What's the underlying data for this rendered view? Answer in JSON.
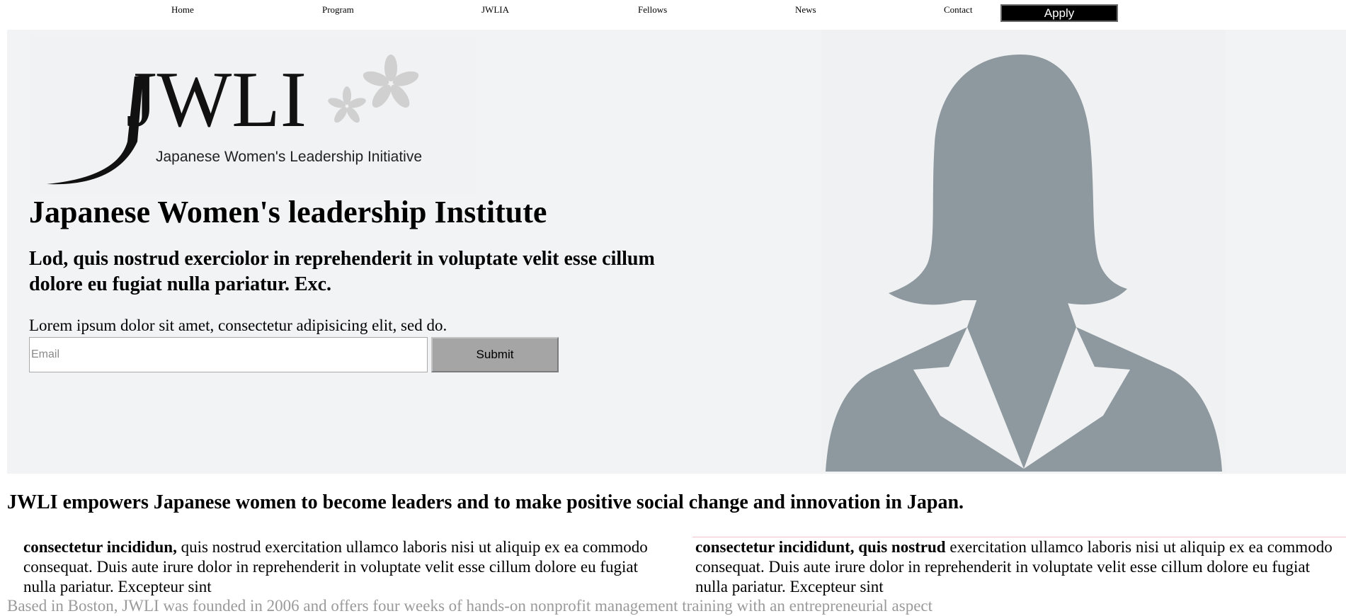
{
  "nav": {
    "items": [
      "Home",
      "Program",
      "JWLIA",
      "Fellows",
      "News",
      "Contact"
    ],
    "apply_label": "Apply"
  },
  "hero": {
    "logo": {
      "wordmark": "JWLI",
      "tagline": "Japanese Women's Leadership Initiative"
    },
    "title": "Japanese Women's leadership Institute",
    "subtitle": "Lod, quis nostrud exerciolor in reprehenderit in voluptate velit esse cillum dolore eu fugiat nulla pariatur. Exc.",
    "text": "Lorem ipsum dolor sit amet, consectetur adipisicing elit, sed do.",
    "email_placeholder": "Email",
    "submit_label": "Submit"
  },
  "mission": "JWLI empowers Japanese women to become leaders and to make positive social change and innovation in Japan.",
  "columns": [
    {
      "bold": "consectetur incididun,",
      "text": " quis nostrud exercitation ullamco laboris nisi ut aliquip ex ea commodo consequat. Duis aute irure dolor in reprehenderit in voluptate velit esse cillum dolore eu fugiat nulla pariatur. Excepteur sint"
    },
    {
      "bold": "consectetur incididunt, quis nostrud",
      "text": " exercitation ullamco laboris nisi ut aliquip ex ea commodo consequat. Duis aute irure dolor in reprehenderit in voluptate velit esse cillum dolore eu fugiat nulla pariatur. Excepteur sint"
    }
  ],
  "based_text": "Based in Boston, JWLI was founded in 2006 and offers four weeks of hands-on nonprofit management training with an entrepreneurial aspect",
  "colors": {
    "hero_bg": "#f2f3f4",
    "silhouette": "#8e989f",
    "apply_bg": "#000000",
    "submit_bg": "#a5a5a5",
    "sakura": "#d0d0d0"
  }
}
